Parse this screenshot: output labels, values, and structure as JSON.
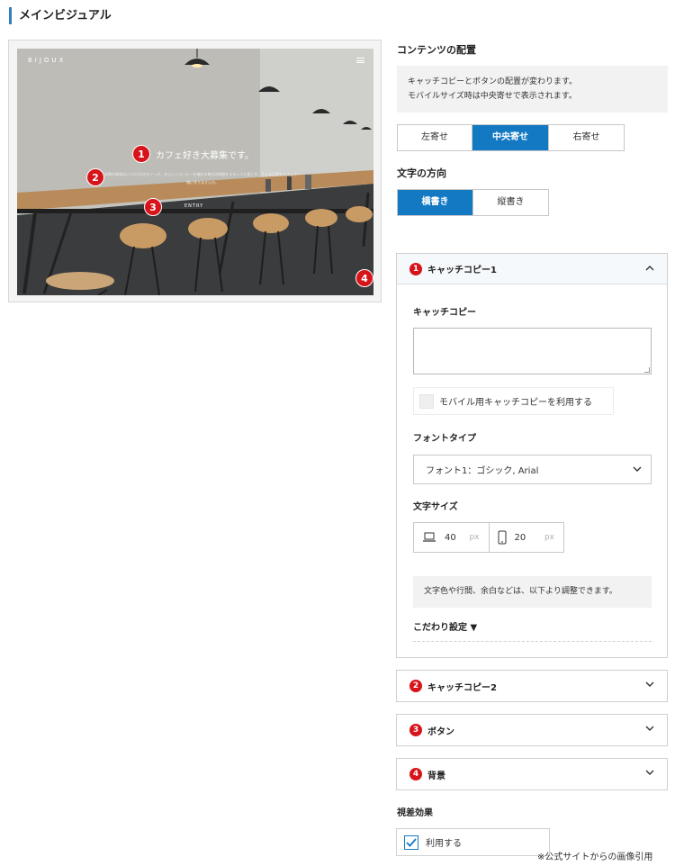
{
  "section_title": "メインビジュアル",
  "preview": {
    "brand": "BIJOUX",
    "catch_copy": "カフェ好き大募集です。",
    "sub_text": "毎朝の珈琲はいつも1日のスイッチ。おいしいコーヒーを淹れる毎日の時間をスタッフと過ごす。そんな日常をカフェで一緒に作りませんか。",
    "entry_label": "ENTRY",
    "markers": [
      "1",
      "2",
      "3",
      "4"
    ]
  },
  "layout_section": {
    "label": "コンテンツの配置",
    "note_line1": "キャッチコピーとボタンの配置が変わります。",
    "note_line2": "モバイルサイズ時は中央寄せで表示されます。",
    "options": [
      "左寄せ",
      "中央寄せ",
      "右寄せ"
    ],
    "selected": "中央寄せ"
  },
  "direction_section": {
    "label": "文字の方向",
    "options": [
      "横書き",
      "縦書き"
    ],
    "selected": "横書き"
  },
  "accordions": [
    {
      "num": "1",
      "title": "キャッチコピー1",
      "expanded": true
    },
    {
      "num": "2",
      "title": "キャッチコピー2",
      "expanded": false
    },
    {
      "num": "3",
      "title": "ボタン",
      "expanded": false
    },
    {
      "num": "4",
      "title": "背景",
      "expanded": false
    }
  ],
  "catch1": {
    "field_label": "キャッチコピー",
    "textarea_value": "",
    "mobile_checkbox_label": "モバイル用キャッチコピーを利用する",
    "mobile_checked": false,
    "font_type_label": "フォントタイプ",
    "font_type_value": "フォント1：ゴシック, Arial",
    "font_size_label": "文字サイズ",
    "pc_size": "40",
    "mobile_size": "20",
    "unit": "px",
    "note": "文字色や行間、余白などは、以下より調整できます。",
    "advanced_label": "こだわり設定 ▼"
  },
  "parallax": {
    "label": "視差効果",
    "checkbox_label": "利用する",
    "checked": true
  },
  "credit": "※公式サイトからの画像引用",
  "colors": {
    "accent": "#1479c3",
    "marker": "#d8141b",
    "title_bar": "#2e7fc1"
  }
}
